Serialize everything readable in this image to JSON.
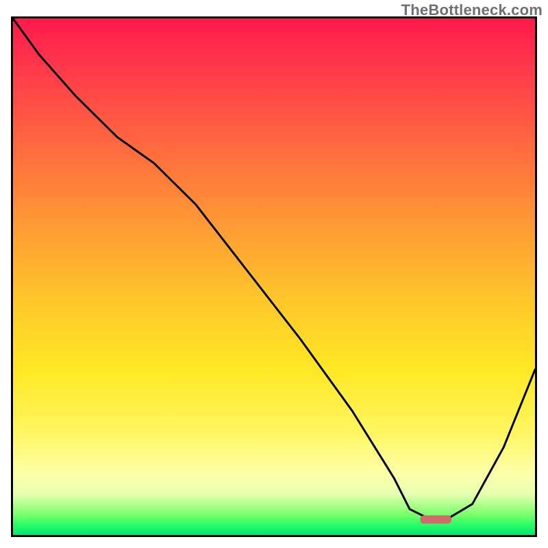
{
  "watermark": {
    "text": "TheBottleneck.com"
  },
  "chart_data": {
    "type": "line",
    "title": "",
    "xlabel": "",
    "ylabel": "",
    "xlim": [
      0,
      100
    ],
    "ylim": [
      0,
      100
    ],
    "background_gradient": {
      "top_color": "#ff1a4d",
      "bottom_color": "#00e676",
      "note": "vertical gradient red→orange→yellow→green representing bottleneck severity"
    },
    "series": [
      {
        "name": "bottleneck-curve",
        "x": [
          0,
          5,
          12,
          20,
          27,
          35,
          45,
          55,
          65,
          73,
          76,
          80,
          83,
          88,
          94,
          100
        ],
        "y": [
          100,
          93,
          85,
          77,
          72,
          64,
          51,
          38,
          24,
          11,
          5,
          3,
          3,
          6,
          17,
          32
        ]
      }
    ],
    "marker": {
      "name": "optimal-range",
      "x_start": 78,
      "x_end": 84,
      "y": 3,
      "color": "#d16b6b"
    }
  }
}
